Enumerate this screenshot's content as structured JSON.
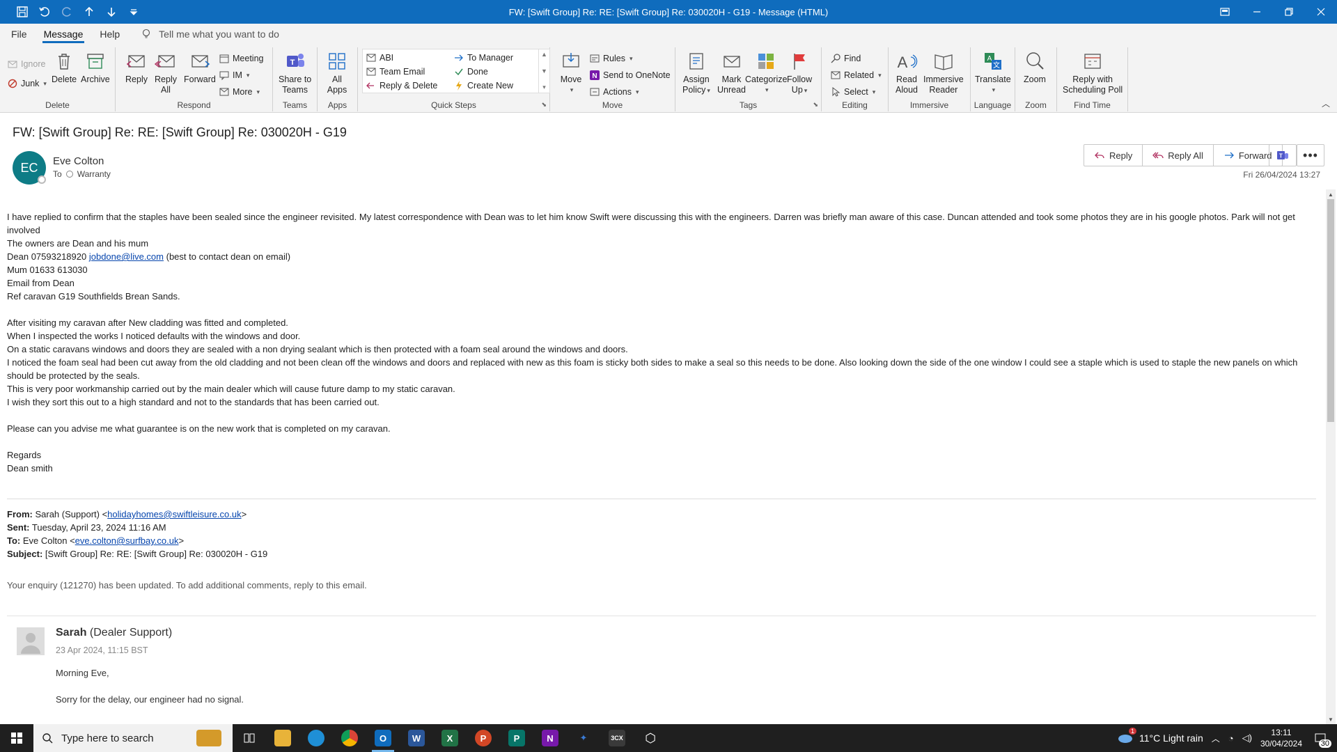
{
  "window": {
    "title": "FW: [Swift Group] Re: RE: [Swift Group] Re: 030020H - G19  -  Message (HTML)"
  },
  "menu": {
    "tabs": [
      "File",
      "Message",
      "Help"
    ],
    "tell_me": "Tell me what you want to do"
  },
  "ribbon": {
    "groups": {
      "delete": "Delete",
      "respond": "Respond",
      "teams": "Teams",
      "apps": "Apps",
      "quick_steps": "Quick Steps",
      "move": "Move",
      "tags": "Tags",
      "editing": "Editing",
      "immersive": "Immersive",
      "language": "Language",
      "zoom": "Zoom",
      "find_time": "Find Time"
    },
    "ignore": "Ignore",
    "junk": "Junk",
    "delete": "Delete",
    "archive": "Archive",
    "reply": "Reply",
    "reply_all_1": "Reply",
    "reply_all_2": "All",
    "forward": "Forward",
    "meeting": "Meeting",
    "im": "IM",
    "more": "More",
    "share_teams_1": "Share to",
    "share_teams_2": "Teams",
    "all_apps_1": "All",
    "all_apps_2": "Apps",
    "qs_abi": "ABI",
    "qs_team_email": "Team Email",
    "qs_reply_delete": "Reply & Delete",
    "qs_to_manager": "To Manager",
    "qs_done": "Done",
    "qs_create_new": "Create New",
    "move": "Move",
    "rules": "Rules",
    "onenote": "Send to OneNote",
    "actions": "Actions",
    "assign_policy_1": "Assign",
    "assign_policy_2": "Policy",
    "mark_unread_1": "Mark",
    "mark_unread_2": "Unread",
    "categorize": "Categorize",
    "follow_up_1": "Follow",
    "follow_up_2": "Up",
    "find": "Find",
    "related": "Related",
    "select": "Select",
    "read_aloud_1": "Read",
    "read_aloud_2": "Aloud",
    "immersive_reader_1": "Immersive",
    "immersive_reader_2": "Reader",
    "translate": "Translate",
    "zoom": "Zoom",
    "reply_poll_1": "Reply with",
    "reply_poll_2": "Scheduling Poll"
  },
  "message": {
    "subject": "FW: [Swift Group] Re: RE: [Swift Group] Re: 030020H - G19",
    "avatar_initials": "EC",
    "sender": "Eve Colton",
    "to_label": "To",
    "to_value": "Warranty",
    "date": "Fri 26/04/2024 13:27",
    "actions": {
      "reply": "Reply",
      "reply_all": "Reply All",
      "forward": "Forward"
    }
  },
  "body": {
    "p1": "I have replied to confirm that the staples have been sealed since the engineer revisited. My latest correspondence with Dean was to let him know Swift were discussing this with the engineers. Darren was briefly man aware of this case. Duncan attended and took some photos they are in his google photos. Park will not get involved",
    "p2": "The owners are Dean and his mum",
    "p3_pre": "Dean 07593218920 ",
    "p3_link": "jobdone@live.com",
    "p3_post": " (best to contact dean on email)",
    "p4": "Mum 01633 613030",
    "p5": "Email from Dean",
    "p6": "Ref caravan G19 Southfields Brean Sands.",
    "p7": "After visiting my caravan after New cladding was fitted and completed.",
    "p8": "When I inspected the works I noticed defaults with the windows and door.",
    "p9": "On a static caravans windows and doors they are sealed with a non drying  sealant which is then protected with a foam seal around the windows and doors.",
    "p10": "I noticed the foam seal had been cut away from the old cladding and not been clean off the windows and doors and replaced with new as this foam is sticky both sides to make a seal so this needs to be done. Also looking down the side of the one window I could see a staple which is used to staple the new panels on which should be protected by the seals.",
    "p11": "This is very poor workmanship carried out by the main dealer which will cause future damp to my static caravan.",
    "p12": "I wish they sort this out to a high standard and not to the standards that has been carried out.",
    "p13": "Please can you advise me what guarantee is on the new work that is completed on my caravan.",
    "p14": "Regards",
    "p15": "Dean smith",
    "fwd": {
      "from_label": "From:",
      "from_pre": "Sarah (Support) <",
      "from_link": "holidayhomes@swiftleisure.co.uk",
      "from_post": ">",
      "sent_label": "Sent:",
      "sent_value": "Tuesday, April 23, 2024 11:16 AM",
      "to_label": "To:",
      "to_pre": "Eve Colton <",
      "to_link": "eve.colton@surfbay.co.uk",
      "to_post": ">",
      "subject_label": "Subject:",
      "subject_value": "[Swift Group] Re: RE: [Swift Group] Re: 030020H - G19"
    },
    "enquiry": "Your enquiry (121270) has been updated. To add additional comments, reply to this email.",
    "card": {
      "name": "Sarah",
      "role": " (Dealer Support)",
      "when": "23 Apr 2024, 11:15 BST",
      "line1": "Morning Eve,",
      "line2": "Sorry for the delay, our engineer had no signal."
    }
  },
  "taskbar": {
    "search_placeholder": "Type here to search",
    "weather": "11°C  Light rain",
    "time": "13:11",
    "date": "30/04/2024",
    "notifications": "30",
    "weather_badge": "1"
  }
}
